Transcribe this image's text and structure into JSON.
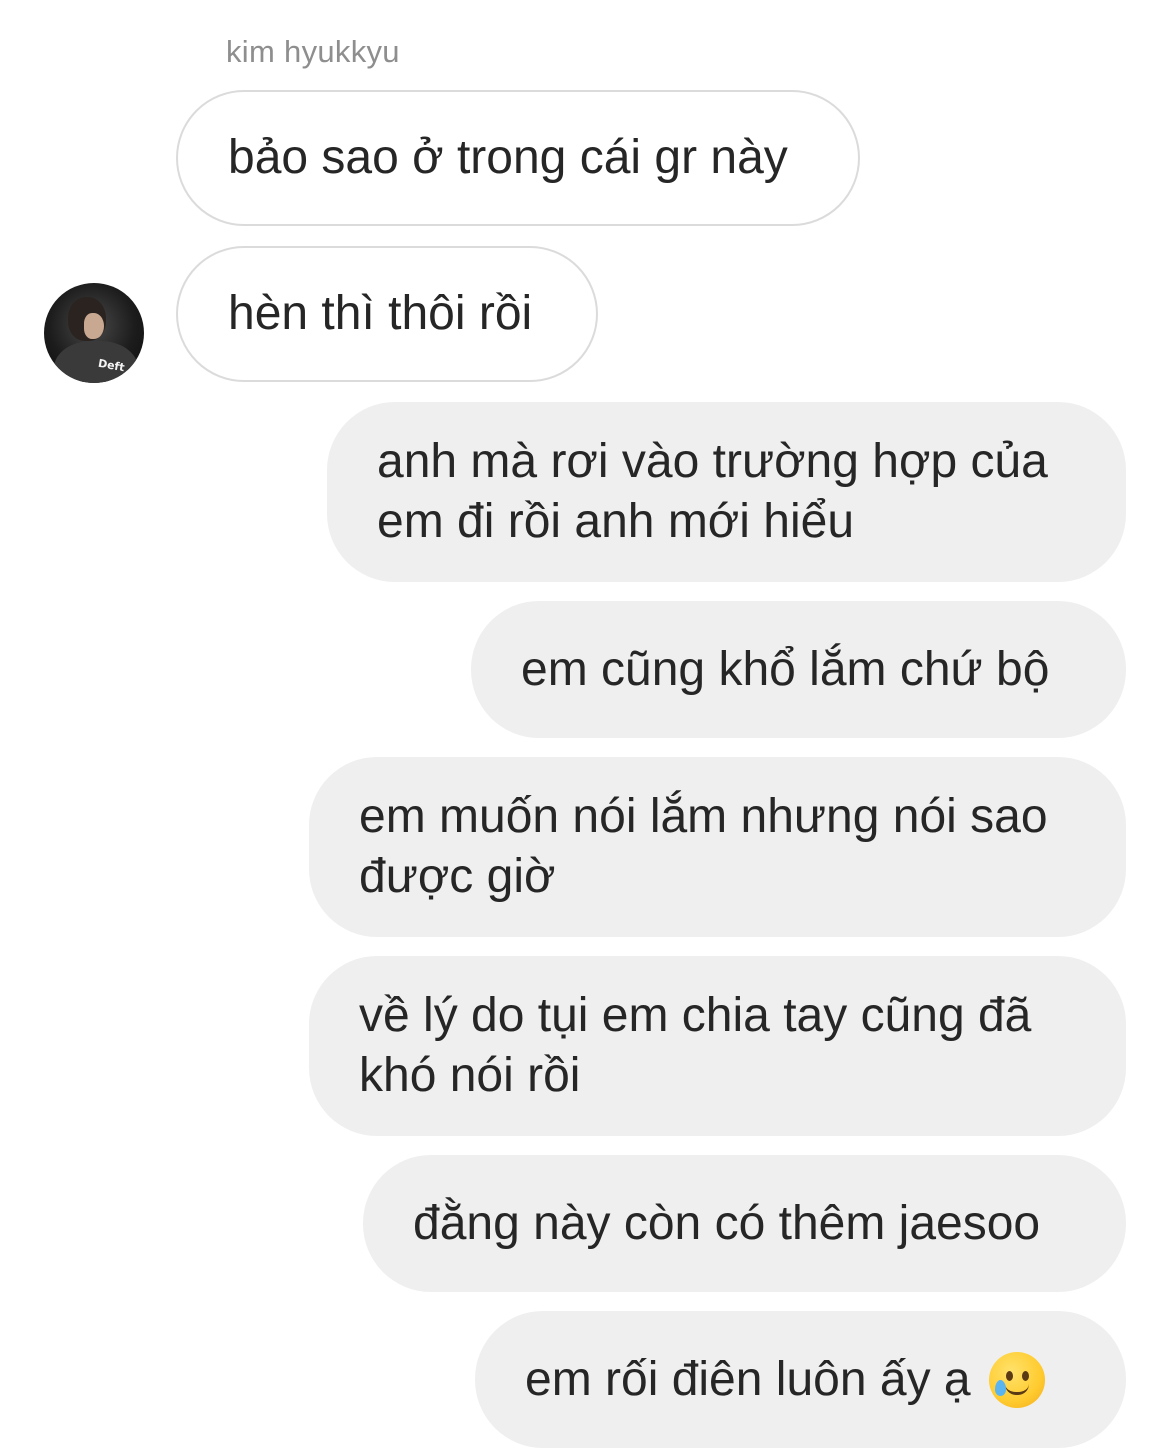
{
  "thread": {
    "sender_name": "kim hyukkyu",
    "avatar_label": "Deft"
  },
  "messages": [
    {
      "direction": "incoming",
      "text": "bảo sao ở trong cái gr này"
    },
    {
      "direction": "incoming",
      "text": "hèn thì thôi rồi"
    },
    {
      "direction": "outgoing",
      "text": "anh mà rơi vào trường hợp của\nem đi rồi anh mới hiểu"
    },
    {
      "direction": "outgoing",
      "text": "em cũng khổ lắm chứ bộ"
    },
    {
      "direction": "outgoing",
      "text": "em muốn nói lắm nhưng nói sao\nđược giờ"
    },
    {
      "direction": "outgoing",
      "text": "về lý do tụi em chia tay cũng đã\nkhó nói rồi"
    },
    {
      "direction": "outgoing",
      "text": "đằng này còn có thêm jaesoo"
    },
    {
      "direction": "outgoing",
      "text": "em rối điên luôn ấy ạ",
      "emoji": "smiling-face-with-tear-icon"
    }
  ],
  "colors": {
    "incoming_bubble_border": "#dbdbdb",
    "outgoing_bubble_bg": "#efefef",
    "text": "#262626",
    "sender_name": "#8e8e8e"
  }
}
